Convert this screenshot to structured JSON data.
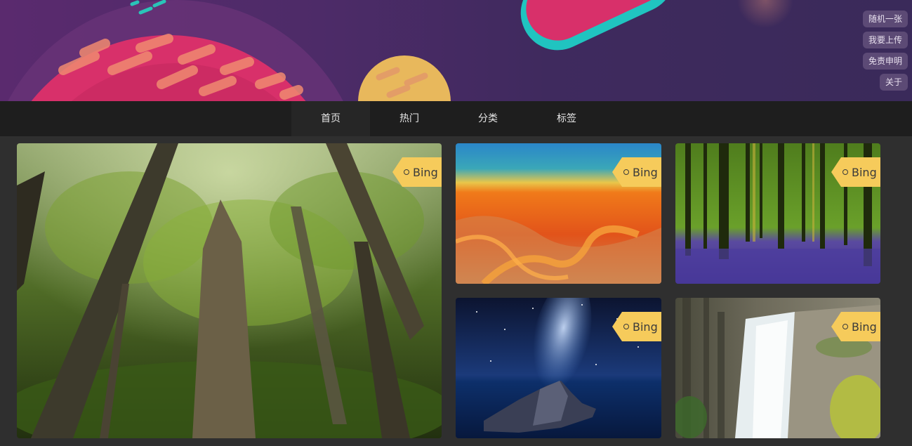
{
  "side_menu": {
    "random": "随机一张",
    "upload": "我要上传",
    "disclaimer": "免责申明",
    "about": "关于"
  },
  "nav": {
    "items": [
      "首页",
      "热门",
      "分类",
      "标签"
    ],
    "active": "首页"
  },
  "gallery": {
    "cards": [
      {
        "source": "Bing",
        "subject": "forest-canopy"
      },
      {
        "source": "Bing",
        "subject": "hot-spring"
      },
      {
        "source": "Bing",
        "subject": "bluebell-forest"
      },
      {
        "source": "Bing",
        "subject": "milky-way-coast"
      },
      {
        "source": "Bing",
        "subject": "waterfall"
      }
    ]
  },
  "colors": {
    "banner_purple": "#4d2b68",
    "nav_bg": "#1e1e1e",
    "page_bg": "#2f2f2f",
    "tag_yellow": "#f6cb5b"
  }
}
